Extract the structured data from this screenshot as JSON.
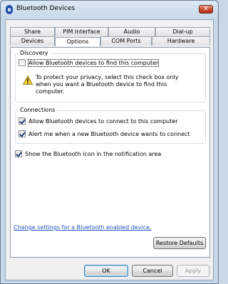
{
  "window": {
    "title": "Bluetooth Devices",
    "close_glyph": "✕",
    "icon_glyph": "ʙ"
  },
  "tabs_back": [
    "Share",
    "PIM Interface",
    "Audio",
    "Dial-up"
  ],
  "tabs_front": [
    "Devices",
    "Options",
    "COM Ports",
    "Hardware"
  ],
  "selected_tab": "Options",
  "discovery": {
    "legend": "Discovery",
    "allow_find": {
      "label": "Allow Bluetooth devices to find this computer",
      "checked": false
    },
    "note": "To protect your privacy, select this check box only when you want a Bluetooth device to find this computer."
  },
  "connections": {
    "legend": "Connections",
    "allow_connect": {
      "label": "Allow Bluetooth devices to connect to this computer",
      "checked": true
    },
    "alert_new": {
      "label": "Alert me when a new Bluetooth device wants to connect",
      "checked": true
    }
  },
  "show_icon": {
    "label": "Show the Bluetooth icon in the notification area",
    "checked": true
  },
  "change_settings_link": "Change settings for a Bluetooth enabled device.",
  "buttons": {
    "restore_defaults": "Restore Defaults",
    "ok": "OK",
    "cancel": "Cancel",
    "apply": "Apply"
  }
}
